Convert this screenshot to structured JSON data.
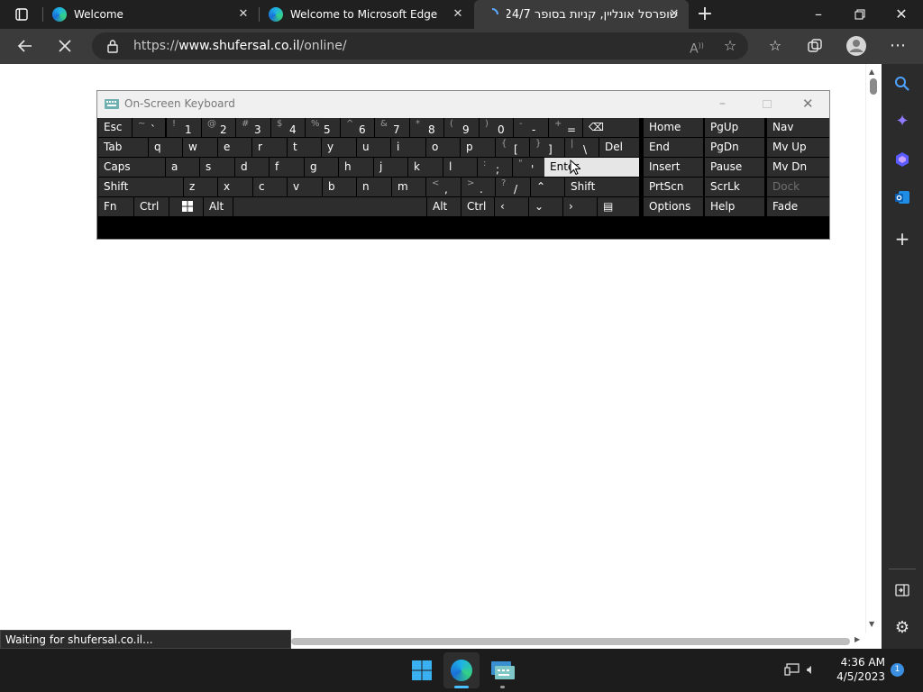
{
  "browser": {
    "tabs": [
      {
        "title": "Welcome",
        "active": false
      },
      {
        "title": "Welcome to Microsoft Edge",
        "active": false
      },
      {
        "title": "שופרסל אונליין, קניות בסופר 24/7",
        "active": true
      }
    ],
    "url_prefix": "https://",
    "url_domain": "www.shufersal.co.il",
    "url_path": "/online/",
    "status_text": "Waiting for shufersal.co.il..."
  },
  "osk": {
    "title": "On-Screen Keyboard",
    "keys": [
      {
        "name": "key-esc",
        "label": "Esc"
      },
      {
        "name": "key-tilde",
        "label": "`",
        "shift": "~"
      },
      {
        "name": "key-1",
        "label": "1",
        "shift": "!"
      },
      {
        "name": "key-2",
        "label": "2",
        "shift": "@"
      },
      {
        "name": "key-3",
        "label": "3",
        "shift": "#"
      },
      {
        "name": "key-4",
        "label": "4",
        "shift": "$"
      },
      {
        "name": "key-5",
        "label": "5",
        "shift": "%"
      },
      {
        "name": "key-6",
        "label": "6",
        "shift": "^"
      },
      {
        "name": "key-7",
        "label": "7",
        "shift": "&"
      },
      {
        "name": "key-8",
        "label": "8",
        "shift": "*"
      },
      {
        "name": "key-9",
        "label": "9",
        "shift": "("
      },
      {
        "name": "key-0",
        "label": "0",
        "shift": ")"
      },
      {
        "name": "key-minus",
        "label": "-",
        "shift": "-"
      },
      {
        "name": "key-equals",
        "label": "=",
        "shift": "+"
      },
      {
        "name": "key-backspace",
        "label": "⌫"
      },
      {
        "name": "key-home",
        "label": "Home"
      },
      {
        "name": "key-pgup",
        "label": "PgUp"
      },
      {
        "name": "key-nav",
        "label": "Nav"
      },
      {
        "name": "key-tab",
        "label": "Tab"
      },
      {
        "name": "key-q",
        "label": "q"
      },
      {
        "name": "key-w",
        "label": "w"
      },
      {
        "name": "key-e",
        "label": "e"
      },
      {
        "name": "key-r",
        "label": "r"
      },
      {
        "name": "key-t",
        "label": "t"
      },
      {
        "name": "key-y",
        "label": "y"
      },
      {
        "name": "key-u",
        "label": "u"
      },
      {
        "name": "key-i",
        "label": "i"
      },
      {
        "name": "key-o",
        "label": "o"
      },
      {
        "name": "key-p",
        "label": "p"
      },
      {
        "name": "key-lbracket",
        "label": "[",
        "shift": "{"
      },
      {
        "name": "key-rbracket",
        "label": "]",
        "shift": "}"
      },
      {
        "name": "key-backslash",
        "label": "\\",
        "shift": "|"
      },
      {
        "name": "key-del",
        "label": "Del"
      },
      {
        "name": "key-end",
        "label": "End"
      },
      {
        "name": "key-pgdn",
        "label": "PgDn"
      },
      {
        "name": "key-mvup",
        "label": "Mv Up"
      },
      {
        "name": "key-caps",
        "label": "Caps"
      },
      {
        "name": "key-a",
        "label": "a"
      },
      {
        "name": "key-s",
        "label": "s"
      },
      {
        "name": "key-d",
        "label": "d"
      },
      {
        "name": "key-f",
        "label": "f"
      },
      {
        "name": "key-g",
        "label": "g"
      },
      {
        "name": "key-h",
        "label": "h"
      },
      {
        "name": "key-j",
        "label": "j"
      },
      {
        "name": "key-k",
        "label": "k"
      },
      {
        "name": "key-l",
        "label": "l"
      },
      {
        "name": "key-semicolon",
        "label": ";",
        "shift": ":"
      },
      {
        "name": "key-quote",
        "label": "'",
        "shift": "\""
      },
      {
        "name": "key-enter",
        "label": "Enter"
      },
      {
        "name": "key-insert",
        "label": "Insert"
      },
      {
        "name": "key-pause",
        "label": "Pause"
      },
      {
        "name": "key-mvdn",
        "label": "Mv Dn"
      },
      {
        "name": "key-shift-left",
        "label": "Shift"
      },
      {
        "name": "key-z",
        "label": "z"
      },
      {
        "name": "key-x",
        "label": "x"
      },
      {
        "name": "key-c",
        "label": "c"
      },
      {
        "name": "key-v",
        "label": "v"
      },
      {
        "name": "key-b",
        "label": "b"
      },
      {
        "name": "key-n",
        "label": "n"
      },
      {
        "name": "key-m",
        "label": "m"
      },
      {
        "name": "key-comma",
        "label": ",",
        "shift": "<"
      },
      {
        "name": "key-period",
        "label": ".",
        "shift": ">"
      },
      {
        "name": "key-slash",
        "label": "/",
        "shift": "?"
      },
      {
        "name": "key-arrow-up",
        "label": "⌃"
      },
      {
        "name": "key-shift-right",
        "label": "Shift"
      },
      {
        "name": "key-prtscn",
        "label": "PrtScn"
      },
      {
        "name": "key-scrlk",
        "label": "ScrLk"
      },
      {
        "name": "key-dock",
        "label": "Dock"
      },
      {
        "name": "key-fn",
        "label": "Fn"
      },
      {
        "name": "key-ctrl-left",
        "label": "Ctrl"
      },
      {
        "name": "key-win",
        "label": ""
      },
      {
        "name": "key-alt-left",
        "label": "Alt"
      },
      {
        "name": "key-space",
        "label": ""
      },
      {
        "name": "key-alt-right",
        "label": "Alt"
      },
      {
        "name": "key-ctrl-right",
        "label": "Ctrl"
      },
      {
        "name": "key-arrow-left",
        "label": "‹"
      },
      {
        "name": "key-arrow-down",
        "label": "⌄"
      },
      {
        "name": "key-arrow-right",
        "label": "›"
      },
      {
        "name": "key-menu",
        "label": "▤"
      },
      {
        "name": "key-options",
        "label": "Options"
      },
      {
        "name": "key-help",
        "label": "Help"
      },
      {
        "name": "key-fade",
        "label": "Fade"
      }
    ]
  },
  "taskbar": {
    "time": "4:36 AM",
    "date": "4/5/2023",
    "notification_count": "1"
  }
}
